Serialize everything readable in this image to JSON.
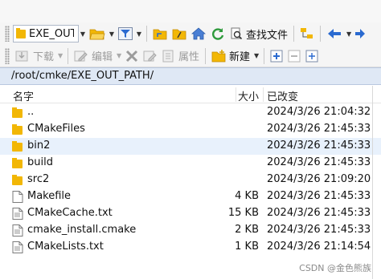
{
  "toolbar1": {
    "path_combo_text": "EXE_OUT_PATH",
    "find_files_label": "查找文件"
  },
  "toolbar2": {
    "download_label": "下载",
    "edit_label": "编辑",
    "properties_label": "属性",
    "new_label": "新建"
  },
  "current_path": "/root/cmke/EXE_OUT_PATH/",
  "columns": {
    "name": "名字",
    "size": "大小",
    "modified": "已改变"
  },
  "files": [
    {
      "name": "..",
      "size": "",
      "modified": "2024/3/26 21:04:32",
      "type": "folder",
      "icon": "folder-up-icon"
    },
    {
      "name": "CMakeFiles",
      "size": "",
      "modified": "2024/3/26 21:45:33",
      "type": "folder",
      "icon": "folder-icon"
    },
    {
      "name": "bin2",
      "size": "",
      "modified": "2024/3/26 21:45:33",
      "type": "folder",
      "icon": "folder-icon"
    },
    {
      "name": "build",
      "size": "",
      "modified": "2024/3/26 21:45:33",
      "type": "folder",
      "icon": "folder-icon"
    },
    {
      "name": "src2",
      "size": "",
      "modified": "2024/3/26 21:09:20",
      "type": "folder",
      "icon": "folder-icon"
    },
    {
      "name": "Makefile",
      "size": "4 KB",
      "modified": "2024/3/26 21:45:33",
      "type": "file",
      "icon": "file-icon"
    },
    {
      "name": "CMakeCache.txt",
      "size": "15 KB",
      "modified": "2024/3/26 21:45:33",
      "type": "file",
      "icon": "text-file-icon"
    },
    {
      "name": "cmake_install.cmake",
      "size": "2 KB",
      "modified": "2024/3/26 21:45:33",
      "type": "file",
      "icon": "text-file-icon"
    },
    {
      "name": "CMakeLists.txt",
      "size": "1 KB",
      "modified": "2024/3/26 21:14:54",
      "type": "file",
      "icon": "text-file-icon"
    }
  ],
  "selected_row": "bin2",
  "watermark": "CSDN @金色熊族",
  "colors": {
    "folder": "#f2b705",
    "selected_row": "#e8f1fc",
    "path_bar": "#dfe8f5",
    "accent_blue": "#2a6ad0",
    "green": "#2e9a3c"
  }
}
